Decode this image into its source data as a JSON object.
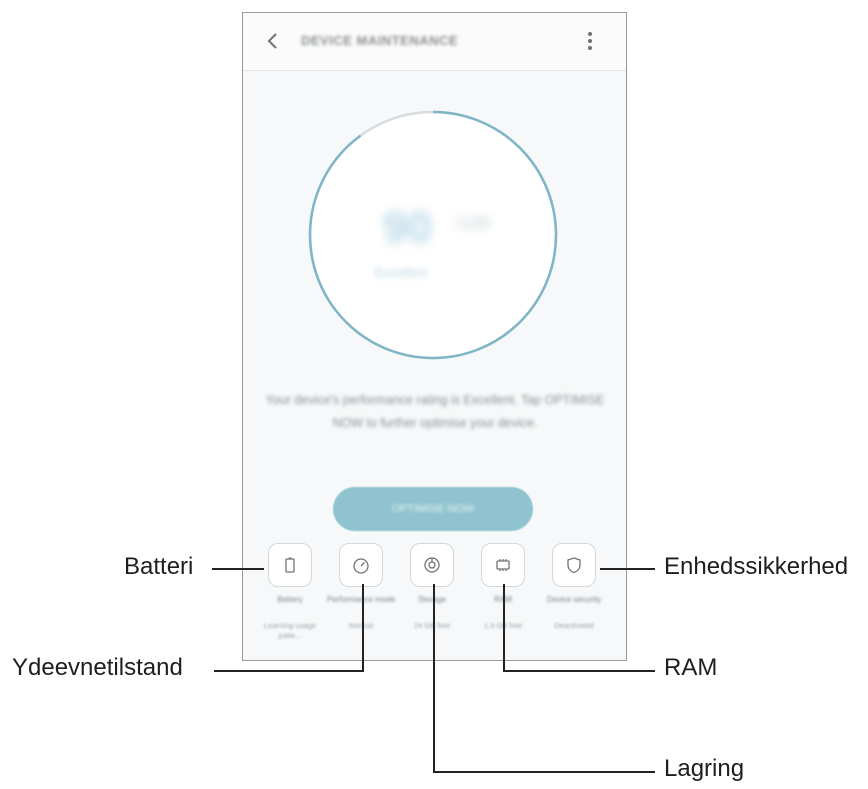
{
  "appbar": {
    "title": "DEVICE MAINTENANCE"
  },
  "score": {
    "value": "90",
    "unit": "/100",
    "label": "Excellent"
  },
  "description": "Your device's performance rating is Excellent. Tap OPTIMISE NOW to further optimise your device.",
  "optimise_button": "OPTIMISE NOW",
  "features": [
    {
      "label": "Battery",
      "status": "Learning usage patte...",
      "icon": "battery-icon"
    },
    {
      "label": "Performance mode",
      "status": "Normal",
      "icon": "speedometer-icon"
    },
    {
      "label": "Storage",
      "status": "24 GB free",
      "icon": "storage-icon"
    },
    {
      "label": "RAM",
      "status": "1.3 GB free",
      "icon": "ram-chip-icon"
    },
    {
      "label": "Device security",
      "status": "Deactivated",
      "icon": "shield-icon"
    }
  ],
  "callouts": {
    "battery": "Batteri",
    "performance": "Ydeevnetilstand",
    "storage": "Lagring",
    "ram": "RAM",
    "security": "Enhedssikkerhed"
  },
  "colors": {
    "accent": "#8fc3cf",
    "ring": "#7fb5c6"
  }
}
